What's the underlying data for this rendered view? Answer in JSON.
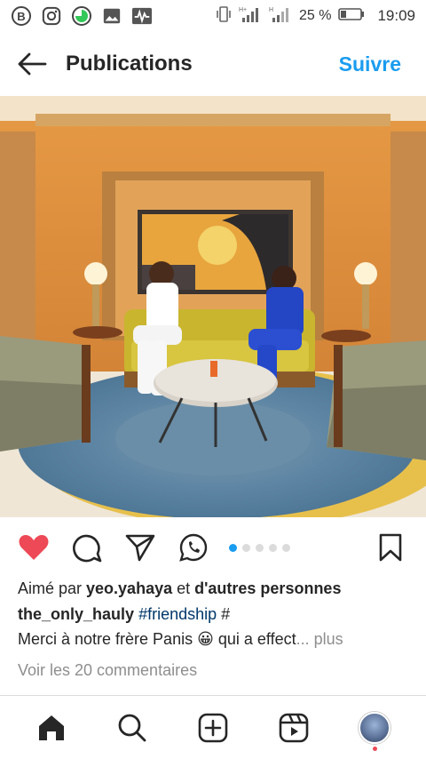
{
  "status_bar": {
    "battery_percent": "25 %",
    "time": "19:09",
    "network_label_1": "H+",
    "network_label_2": "H"
  },
  "header": {
    "title": "Publications",
    "follow_label": "Suivre"
  },
  "post": {
    "carousel_count": 5,
    "carousel_active": 0,
    "likes_prefix": "Aimé par ",
    "likes_user": "yeo.yahaya",
    "likes_middle": " et ",
    "likes_suffix": "d'autres personnes",
    "caption_user": "the_only_hauly",
    "caption_hashtag": "#friendship",
    "caption_rest": " #",
    "caption_line2": "Merci à notre frère Panis 😀 qui a effect",
    "caption_ellipsis": "... ",
    "more_label": "plus",
    "comments_label": "Voir les 20 commentaires"
  },
  "colors": {
    "accent": "#1a9cf0",
    "like_red": "#ed4956",
    "hashtag": "#00376b",
    "muted": "#8e8e8e"
  },
  "icons": {
    "status_left": [
      "b-app-icon",
      "instagram-icon",
      "green-circle-icon",
      "image-icon",
      "activity-icon"
    ],
    "actions": [
      "heart-filled-icon",
      "comment-icon",
      "share-send-icon",
      "whatsapp-icon",
      "bookmark-icon"
    ],
    "nav": [
      "home-icon",
      "search-icon",
      "add-post-icon",
      "reels-icon",
      "profile-avatar"
    ]
  }
}
